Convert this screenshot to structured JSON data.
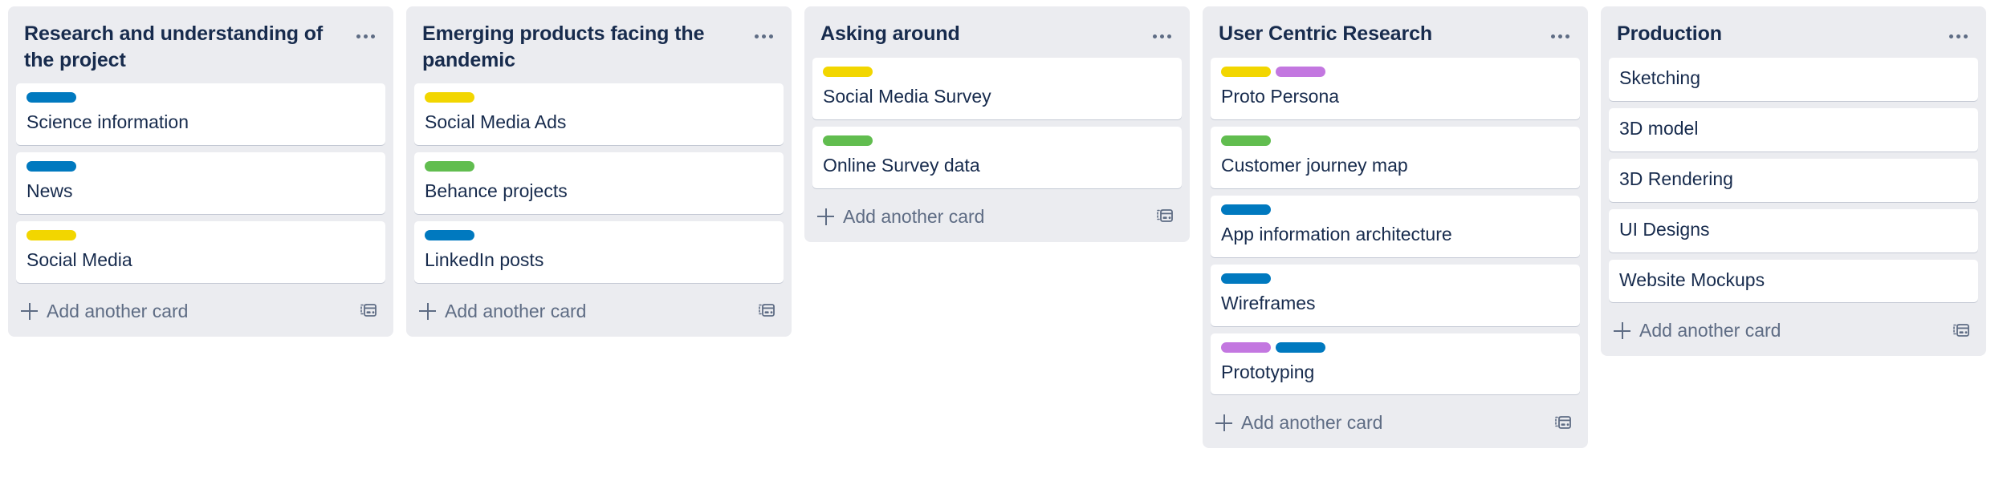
{
  "board": {
    "label_colors": {
      "yellow": "#f2d600",
      "green": "#61bd4f",
      "blue": "#0079bf",
      "purple": "#c377e0"
    },
    "add_card_label": "Add another card",
    "lists": [
      {
        "title": "Research and understanding of the project",
        "cards": [
          {
            "title": "Science information",
            "labels": [
              "blue"
            ]
          },
          {
            "title": "News",
            "labels": [
              "blue"
            ]
          },
          {
            "title": "Social Media",
            "labels": [
              "yellow"
            ]
          }
        ]
      },
      {
        "title": "Emerging products facing the pandemic",
        "cards": [
          {
            "title": "Social Media Ads",
            "labels": [
              "yellow"
            ]
          },
          {
            "title": "Behance projects",
            "labels": [
              "green"
            ]
          },
          {
            "title": "LinkedIn posts",
            "labels": [
              "blue"
            ]
          }
        ]
      },
      {
        "title": "Asking around",
        "cards": [
          {
            "title": "Social Media Survey",
            "labels": [
              "yellow"
            ]
          },
          {
            "title": "Online Survey data",
            "labels": [
              "green"
            ]
          }
        ]
      },
      {
        "title": "User Centric Research",
        "cards": [
          {
            "title": "Proto Persona",
            "labels": [
              "yellow",
              "purple"
            ]
          },
          {
            "title": "Customer journey map",
            "labels": [
              "green"
            ]
          },
          {
            "title": "App information architecture",
            "labels": [
              "blue"
            ]
          },
          {
            "title": "Wireframes",
            "labels": [
              "blue"
            ]
          },
          {
            "title": "Prototyping",
            "labels": [
              "purple",
              "blue"
            ]
          }
        ]
      },
      {
        "title": "Production",
        "cards": [
          {
            "title": "Sketching",
            "labels": []
          },
          {
            "title": "3D model",
            "labels": []
          },
          {
            "title": "3D Rendering",
            "labels": []
          },
          {
            "title": "UI Designs",
            "labels": []
          },
          {
            "title": "Website Mockups",
            "labels": []
          }
        ]
      }
    ]
  }
}
